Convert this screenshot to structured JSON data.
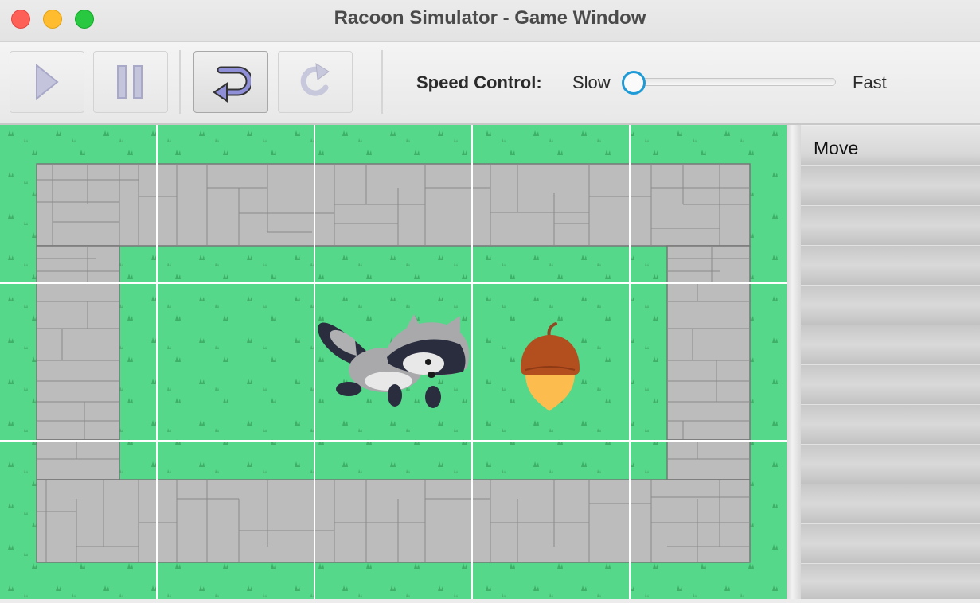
{
  "window": {
    "title": "Racoon Simulator - Game Window"
  },
  "toolbar": {
    "buttons": [
      {
        "name": "play",
        "icon": "play-icon",
        "enabled": false
      },
      {
        "name": "pause",
        "icon": "pause-icon",
        "enabled": false
      },
      {
        "name": "step-over",
        "icon": "step-over-icon",
        "enabled": true
      },
      {
        "name": "step",
        "icon": "redo-icon",
        "enabled": false
      }
    ],
    "speed": {
      "label": "Speed Control:",
      "min_label": "Slow",
      "max_label": "Fast",
      "value": 0
    }
  },
  "game": {
    "grid": {
      "rows": 3,
      "cols": 5
    },
    "racoon": {
      "row": 1,
      "col": 2,
      "facing": "right"
    },
    "acorn": {
      "row": 1,
      "col": 3
    },
    "colors": {
      "grass": "#55d88a",
      "path": "#bcbcbc",
      "path_lines": "#777777",
      "accent": "#1e9bd7"
    }
  },
  "panel": {
    "rows": [
      "Move",
      "",
      "",
      "",
      "",
      "",
      "",
      "",
      "",
      "",
      "",
      ""
    ]
  }
}
